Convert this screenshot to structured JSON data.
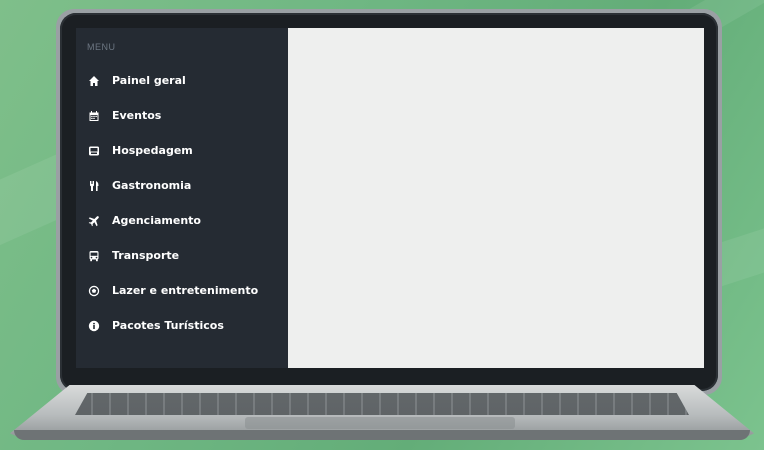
{
  "sidebar": {
    "title": "MENU",
    "items": [
      {
        "label": "Painel geral",
        "icon": "home-icon"
      },
      {
        "label": "Eventos",
        "icon": "calendar-icon"
      },
      {
        "label": "Hospedagem",
        "icon": "bed-icon"
      },
      {
        "label": "Gastronomia",
        "icon": "cutlery-icon"
      },
      {
        "label": "Agenciamento",
        "icon": "plane-icon"
      },
      {
        "label": "Transporte",
        "icon": "bus-icon"
      },
      {
        "label": "Lazer e entretenimento",
        "icon": "soccer-ball-icon"
      },
      {
        "label": "Pacotes Turísticos",
        "icon": "package-icon"
      }
    ]
  },
  "colors": {
    "sidebar_bg": "#252b33",
    "content_bg": "#eeefee",
    "background": "#6fb783"
  }
}
